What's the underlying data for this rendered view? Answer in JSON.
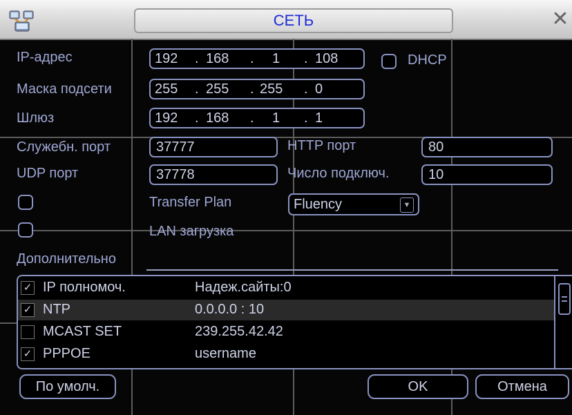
{
  "window": {
    "title": "СЕТЬ"
  },
  "icons": {
    "app": "network-settings-icon",
    "close": "close-icon"
  },
  "colors": {
    "label": "#9fa7d4",
    "title": "#1c2bd6",
    "border": "#8a93c2",
    "background": "#060606"
  },
  "network": {
    "ip": {
      "label": "IP-адрес",
      "octets": [
        "192",
        "168",
        "1",
        "108"
      ]
    },
    "mask": {
      "label": "Маска подсети",
      "octets": [
        "255",
        "255",
        "255",
        "0"
      ]
    },
    "gateway": {
      "label": "Шлюз",
      "octets": [
        "192",
        "168",
        "1",
        "1"
      ]
    },
    "dhcp": {
      "label": "DHCP",
      "checked": false
    },
    "service_port": {
      "label": "Служебн. порт",
      "value": "37777"
    },
    "http_port": {
      "label": "HTTP порт",
      "value": "80"
    },
    "udp_port": {
      "label": "UDP порт",
      "value": "37778"
    },
    "connections": {
      "label": "Число подключ.",
      "value": "10"
    },
    "transfer_plan": {
      "label": "Transfer Plan",
      "value": "Fluency",
      "checked": false
    },
    "lan_download": {
      "label": "LAN загрузка",
      "checked": false
    }
  },
  "advanced": {
    "label": "Дополнительно",
    "items": [
      {
        "name": "IP полномоч.",
        "value": "Надеж.сайты:0",
        "checked": true
      },
      {
        "name": "NTP",
        "value": "0.0.0.0 : 10",
        "checked": true
      },
      {
        "name": "MCAST SET",
        "value": "239.255.42.42",
        "checked": false
      },
      {
        "name": "PPPOE",
        "value": "username",
        "checked": true
      }
    ]
  },
  "buttons": {
    "default": "По умолч.",
    "ok": "OK",
    "cancel": "Отмена"
  }
}
